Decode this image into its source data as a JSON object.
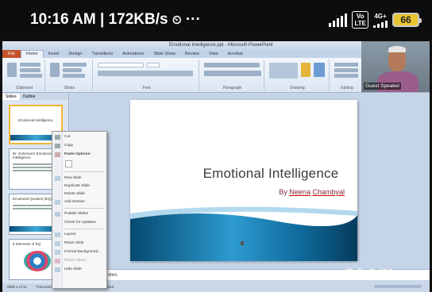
{
  "status_bar": {
    "time_speed": "10:16 AM | 172KB/s",
    "more": "···",
    "volte": "Vo\nLTE",
    "net": "4G+",
    "battery": "66"
  },
  "ppt": {
    "window_title": "Emotional Intelligence.ppt - Microsoft PowerPoint",
    "tabs": [
      "File",
      "Home",
      "Insert",
      "Design",
      "Transitions",
      "Animations",
      "Slide Show",
      "Review",
      "View",
      "Acrobat"
    ],
    "ribbon_groups": [
      "Clipboard",
      "Slides",
      "Font",
      "Paragraph",
      "Drawing",
      "Editing"
    ],
    "pane_tabs": [
      "Slides",
      "Outline"
    ],
    "thumbs": [
      {
        "num": "1",
        "title": "Emotional Intelligence"
      },
      {
        "num": "2",
        "title": "Dr. Goleman's Emotional Intelligence"
      },
      {
        "num": "3",
        "title": "Emotional Quotient (EQ)"
      },
      {
        "num": "4",
        "title": "5 Elements of EQ"
      }
    ],
    "context_menu": {
      "items": [
        "Cut",
        "Copy",
        "Paste Options:",
        "New Slide",
        "Duplicate Slide",
        "Delete Slide",
        "Add Section",
        "Publish Slides",
        "Check for Updates",
        "Layout",
        "Reset Slide",
        "Format Background...",
        "Photo Album...",
        "Hide Slide"
      ]
    },
    "slide": {
      "title": "Emotional Intelligence",
      "by": "By",
      "name_first": "Neena",
      "name_last": "Chambyal"
    },
    "notes_placeholder": "Click to add notes",
    "status_items": [
      "Slide 1 of 11",
      "\"Concourse\"",
      "English (India)",
      "Recovered"
    ]
  },
  "video": {
    "label": "Guest Speaker"
  },
  "watermark": "zoom",
  "colors": {
    "accent_file_tab": "#c3532a",
    "slide_wave": "#1a7fb5",
    "subtitle_text": "#8c2636",
    "battery": "#e8c531"
  }
}
